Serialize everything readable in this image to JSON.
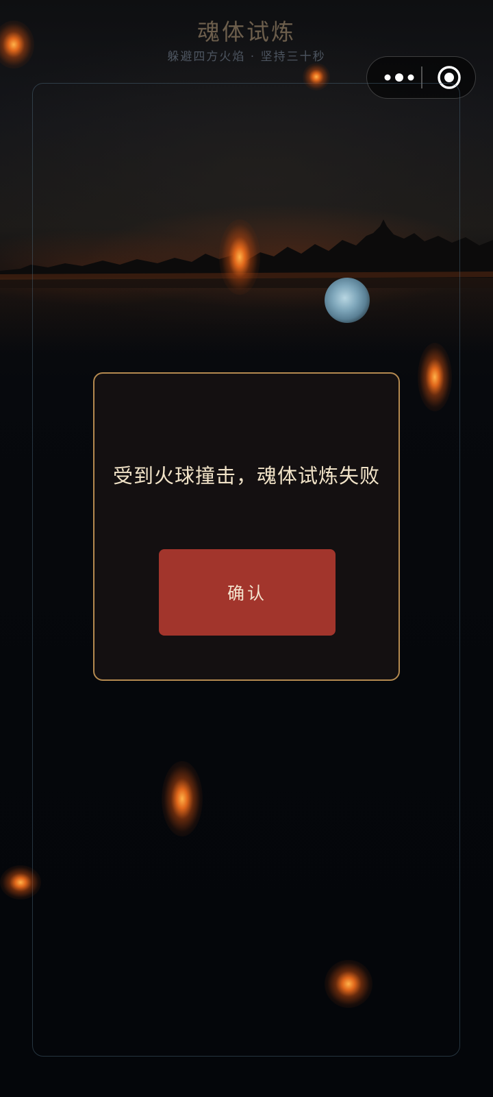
{
  "header": {
    "title": "魂体试炼",
    "subtitle": "躲避四方火焰 · 坚持三十秒"
  },
  "menu_capsule": {
    "more_icon": "more-dots-icon",
    "close_icon": "target-circle-icon"
  },
  "dialog": {
    "message": "受到火球撞击，魂体试炼失败",
    "confirm_label": "确认"
  },
  "colors": {
    "accent_gold": "#b58a50",
    "confirm_red": "#a2352c",
    "message_text": "#f1e3c8",
    "player_orb": "#7ea6ba",
    "fireball_core": "#ffb24a"
  }
}
